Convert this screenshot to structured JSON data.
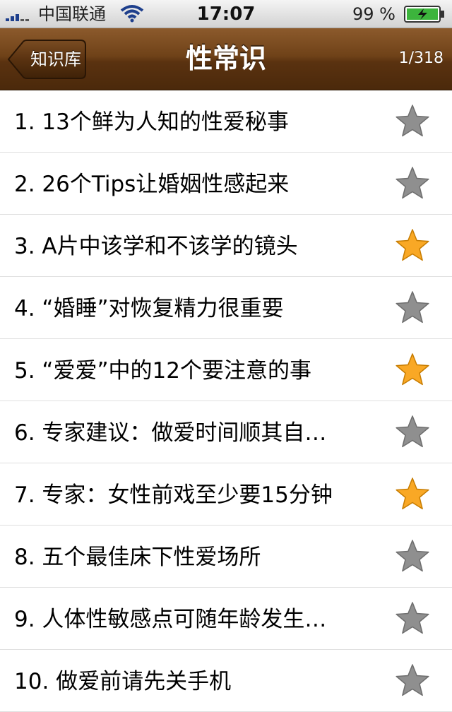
{
  "status_bar": {
    "carrier": "中国联通",
    "time": "17:07",
    "battery": "99 %"
  },
  "nav": {
    "back_label": "知识库",
    "title": "性常识",
    "counter": "1/318"
  },
  "colors": {
    "star_on": "#f9a825",
    "star_off": "#8f8f8f",
    "nav_brown": "#6f4218"
  },
  "articles": [
    {
      "title": "1. 13个鲜为人知的性爱秘事",
      "starred": false
    },
    {
      "title": "2. 26个Tips让婚姻性感起来",
      "starred": false
    },
    {
      "title": "3. A片中该学和不该学的镜头",
      "starred": true
    },
    {
      "title": "4. “婚睡”对恢复精力很重要",
      "starred": false
    },
    {
      "title": "5. “爱爱”中的12个要注意的事",
      "starred": true
    },
    {
      "title": "6. 专家建议：做爱时间顺其自…",
      "starred": false
    },
    {
      "title": "7. 专家：女性前戏至少要15分钟",
      "starred": true
    },
    {
      "title": "8. 五个最佳床下性爱场所",
      "starred": false
    },
    {
      "title": "9. 人体性敏感点可随年龄发生…",
      "starred": false
    },
    {
      "title": "10. 做爱前请先关手机",
      "starred": false
    }
  ]
}
